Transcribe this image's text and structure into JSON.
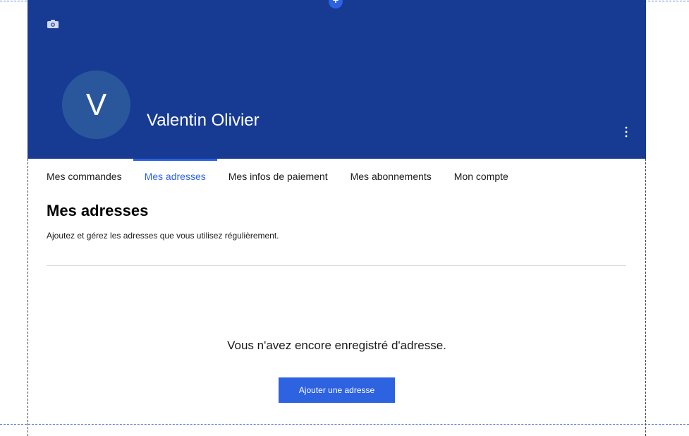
{
  "profile": {
    "avatar_initial": "V",
    "display_name": "Valentin Olivier",
    "banner_color": "#173b93",
    "avatar_color": "#2a579c"
  },
  "icons": {
    "camera": "camera-icon",
    "menu": "kebab-menu-icon",
    "add_section": "plus-icon"
  },
  "tabs": [
    {
      "label": "Mes commandes",
      "active": false
    },
    {
      "label": "Mes adresses",
      "active": true
    },
    {
      "label": "Mes infos de paiement",
      "active": false
    },
    {
      "label": "Mes abonnements",
      "active": false
    },
    {
      "label": "Mon compte",
      "active": false
    }
  ],
  "main": {
    "title": "Mes adresses",
    "description": "Ajoutez et gérez les adresses que vous utilisez régulièrement.",
    "empty_message": "Vous n'avez encore enregistré d'adresse.",
    "add_button_label": "Ajouter une adresse"
  },
  "accent_color": "#2d62e0"
}
